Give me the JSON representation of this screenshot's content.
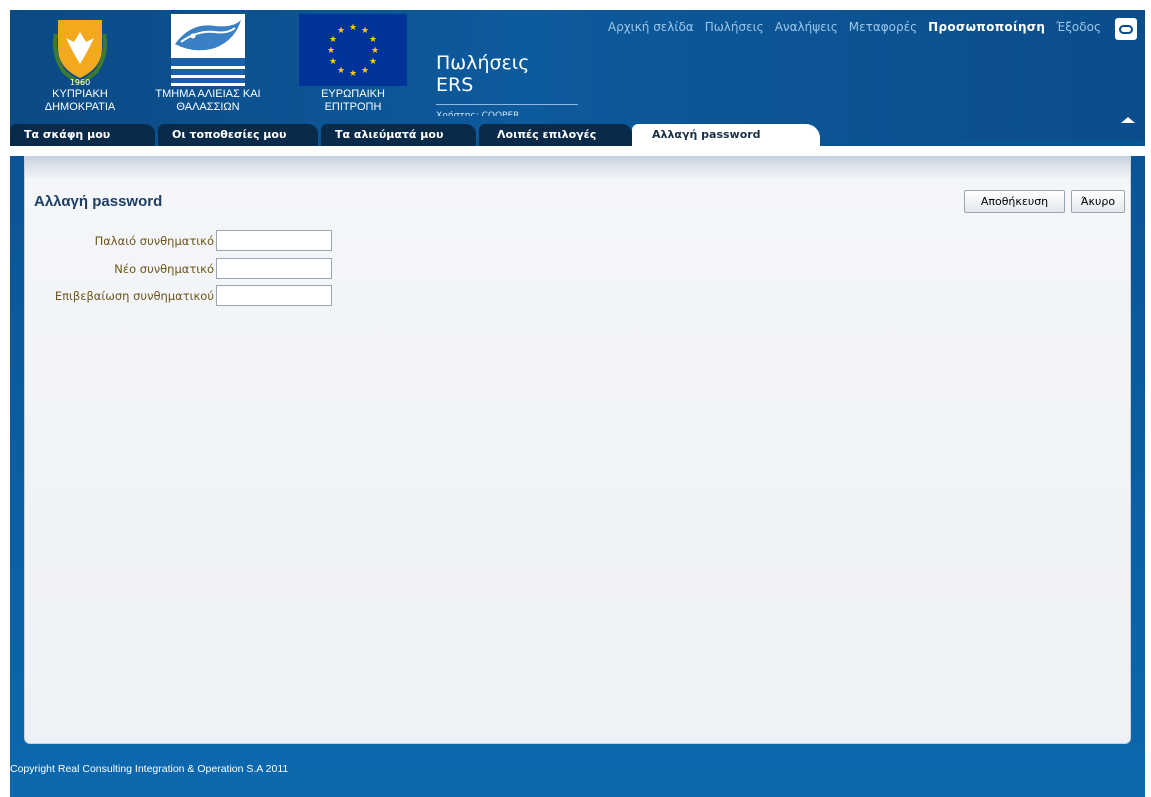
{
  "logos": {
    "cyprus": {
      "caption_line1": "ΚΥΠΡΙΑΚΗ",
      "caption_line2": "ΔΗΜΟΚΡΑΤΙΑ"
    },
    "fisheries": {
      "caption_line1": "ΤΜΗΜΑ ΑΛΙΕΙΑΣ ΚΑΙ",
      "caption_line2": "ΘΑΛΑΣΣΙΩΝ"
    },
    "eu": {
      "caption_line1": "ΕΥΡΩΠΑΙΚΗ",
      "caption_line2": "ΕΠΙΤΡΟΠΗ"
    }
  },
  "app": {
    "title_line1": "Πωλήσεις",
    "title_line2": "ERS",
    "user_line": "Χρήστης: COOPER"
  },
  "topnav": {
    "items": [
      "Αρχική σελίδα",
      "Πωλήσεις",
      "Αναλήψεις",
      "Μεταφορές",
      "Προσωποποίηση",
      "Έξοδος"
    ],
    "active": "Προσωποποίηση"
  },
  "tabs": {
    "items": [
      "Τα σκάφη μου",
      "Οι τοποθεσίες μου",
      "Τα αλιεύματά μου",
      "Λοιπές επιλογές",
      "Αλλαγή password"
    ],
    "active": "Αλλαγή password"
  },
  "page": {
    "title": "Αλλαγή password",
    "save_label": "Αποθήκευση",
    "cancel_label": "Άκυρο"
  },
  "form": {
    "fields": [
      {
        "label": "Παλαιό συνθηματικό",
        "value": ""
      },
      {
        "label": "Νέο συνθηματικό",
        "value": ""
      },
      {
        "label": "Επιβεβαίωση συνθηματικού",
        "value": ""
      }
    ]
  },
  "footer": {
    "copyright": "Copyright Real Consulting Integration & Operation S.A 2011"
  },
  "colors": {
    "header_blue": "#0b4a86",
    "tab_dark": "#0a2a4a",
    "title_blue": "#1f3f66",
    "label_brown": "#6e5419"
  },
  "icons": [
    "cyprus-emblem-icon",
    "fisheries-logo-icon",
    "eu-flag-icon",
    "oracle-icon",
    "collapse-arrow-icon"
  ]
}
